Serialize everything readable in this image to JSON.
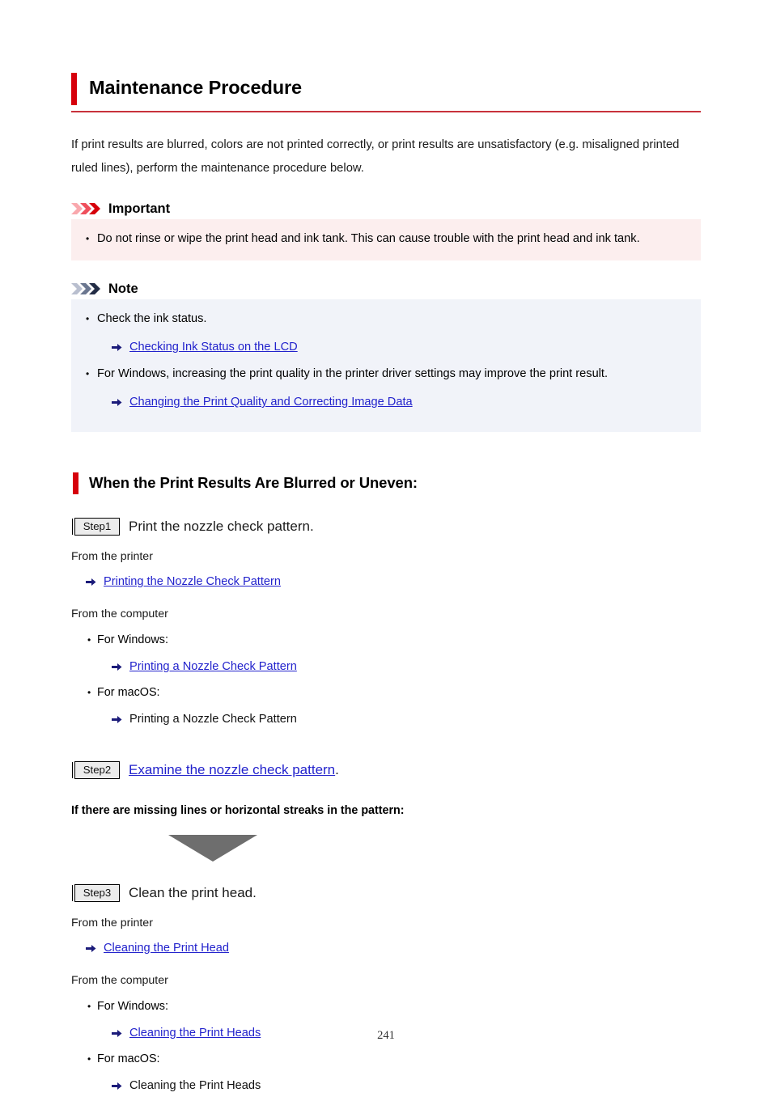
{
  "page": {
    "title": "Maintenance Procedure",
    "number": "241",
    "accent_red": "#d6000b",
    "rule_red": "#c8323c",
    "link_blue": "#2222cc",
    "important_bg": "#fceeee",
    "note_bg": "#f1f3f9",
    "step_badge_bg": "#ececec",
    "triangle_gray": "#6e6e6e"
  },
  "intro": {
    "paragraph": "If print results are blurred, colors are not printed correctly, or print results are unsatisfactory (e.g. misaligned printed ruled lines), perform the maintenance procedure below."
  },
  "important": {
    "icon": "triple-chevron-red-icon",
    "heading": "Important",
    "items": [
      "Do not rinse or wipe the print head and ink tank. This can cause trouble with the print head and ink tank."
    ]
  },
  "note": {
    "icon": "triple-chevron-gray-icon",
    "heading": "Note",
    "items": [
      {
        "text": "Check the ink status.",
        "link": {
          "label": "Checking Ink Status on the LCD",
          "icon": "arrow-right-icon",
          "is_link": true
        }
      },
      {
        "text": "For Windows, increasing the print quality in the printer driver settings may improve the print result.",
        "link": {
          "label": "Changing the Print Quality and Correcting Image Data",
          "icon": "arrow-right-icon",
          "is_link": true
        }
      }
    ]
  },
  "section": {
    "heading": "When the Print Results Are Blurred or Uneven:"
  },
  "step1": {
    "badge": "Step1",
    "title": "Print the nozzle check pattern.",
    "from_printer_label": "From the printer",
    "from_printer_link": {
      "label": "Printing the Nozzle Check Pattern",
      "icon": "arrow-right-icon",
      "is_link": true
    },
    "from_computer_label": "From the computer",
    "os_items": [
      {
        "label": "For Windows:",
        "link": {
          "label": "Printing a Nozzle Check Pattern",
          "icon": "arrow-right-icon",
          "is_link": true
        }
      },
      {
        "label": "For macOS:",
        "link": {
          "label": "Printing a Nozzle Check Pattern",
          "icon": "arrow-right-icon",
          "is_link": false
        }
      }
    ]
  },
  "step2": {
    "badge": "Step2",
    "link_label": "Examine the nozzle check pattern",
    "trailing": ".",
    "condition_text": "If there are missing lines or horizontal streaks in the pattern:",
    "flow_icon": "down-triangle-icon"
  },
  "step3": {
    "badge": "Step3",
    "title": "Clean the print head.",
    "from_printer_label": "From the printer",
    "from_printer_link": {
      "label": "Cleaning the Print Head",
      "icon": "arrow-right-icon",
      "is_link": true
    },
    "from_computer_label": "From the computer",
    "os_items": [
      {
        "label": "For Windows:",
        "link": {
          "label": "Cleaning the Print Heads",
          "icon": "arrow-right-icon",
          "is_link": true
        }
      },
      {
        "label": "For macOS:",
        "link": {
          "label": "Cleaning the Print Heads",
          "icon": "arrow-right-icon",
          "is_link": false
        }
      }
    ]
  }
}
